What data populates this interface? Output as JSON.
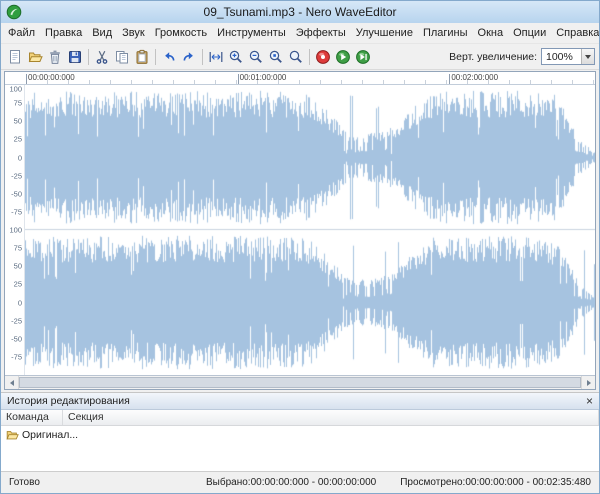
{
  "window": {
    "title": "09_Tsunami.mp3 - Nero WaveEditor"
  },
  "menu": {
    "items": [
      "Файл",
      "Правка",
      "Вид",
      "Звук",
      "Громкость",
      "Инструменты",
      "Эффекты",
      "Улучшение",
      "Плагины",
      "Окна",
      "Опции",
      "Справка"
    ]
  },
  "toolbar": {
    "items": [
      {
        "name": "new-file",
        "icon": "page"
      },
      {
        "name": "open-file",
        "icon": "folder"
      },
      {
        "name": "delete",
        "icon": "trash"
      },
      {
        "name": "save",
        "icon": "floppy"
      },
      {
        "sep": true
      },
      {
        "name": "cut",
        "icon": "scissors"
      },
      {
        "name": "copy",
        "icon": "copy"
      },
      {
        "name": "paste",
        "icon": "clipboard"
      },
      {
        "sep": true
      },
      {
        "name": "undo",
        "icon": "undo"
      },
      {
        "name": "redo",
        "icon": "redo"
      },
      {
        "sep": true
      },
      {
        "name": "zoom-to-selection",
        "icon": "fit-width"
      },
      {
        "name": "zoom-in",
        "icon": "zoom-in"
      },
      {
        "name": "zoom-out",
        "icon": "zoom-out"
      },
      {
        "name": "zoom-region",
        "icon": "zoom-sel"
      },
      {
        "name": "zoom-full",
        "icon": "zoom-all"
      },
      {
        "sep": true
      },
      {
        "name": "record",
        "icon": "record"
      },
      {
        "name": "play",
        "icon": "play"
      },
      {
        "name": "play-all",
        "icon": "play-all"
      }
    ],
    "zoom_label": "Верт. увеличение:",
    "zoom_value": "100%"
  },
  "ruler": {
    "labels": [
      "00:00:00:000",
      "00:01:00:000",
      "00:02:00:000"
    ]
  },
  "waveform": {
    "channels": 2,
    "axis_labels": [
      "100",
      "75",
      "50",
      "25",
      "0",
      "-25",
      "-50",
      "-75"
    ],
    "color": "#a6c3e0",
    "seed": 12,
    "envelope": [
      [
        0,
        0.92
      ],
      [
        0.05,
        0.96
      ],
      [
        0.42,
        0.96
      ],
      [
        0.5,
        0.92
      ],
      [
        0.54,
        0.6
      ],
      [
        0.57,
        0.34
      ],
      [
        0.62,
        0.36
      ],
      [
        0.655,
        0.5
      ],
      [
        0.69,
        0.8
      ],
      [
        0.72,
        0.96
      ],
      [
        0.9,
        0.96
      ],
      [
        0.93,
        0.9
      ],
      [
        0.955,
        0.55
      ],
      [
        0.975,
        0.25
      ],
      [
        1,
        0.07
      ]
    ]
  },
  "history": {
    "title": "История редактирования",
    "close_glyph": "×",
    "columns": [
      "Команда",
      "Секция"
    ],
    "rows": [
      {
        "icon": "folder",
        "label": "Оригинал..."
      }
    ]
  },
  "statusbar": {
    "ready": "Готово",
    "selected": "Выбрано:00:00:00:000 - 00:00:00:000",
    "viewed": "Просмотрено:00:00:00:000 - 00:02:35:480"
  }
}
